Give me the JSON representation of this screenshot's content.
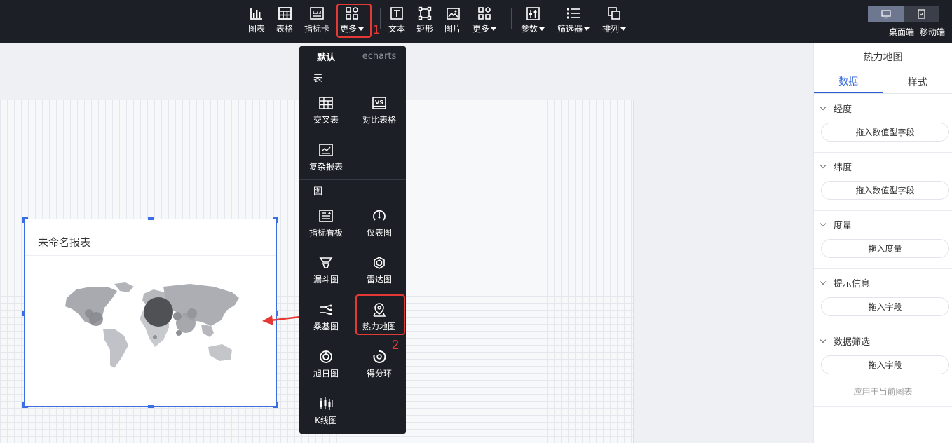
{
  "toolbar": {
    "items": [
      {
        "label": "图表",
        "icon": "bar-chart-icon"
      },
      {
        "label": "表格",
        "icon": "table-icon"
      },
      {
        "label": "指标卡",
        "icon": "metric-card-icon"
      },
      {
        "label": "更多",
        "icon": "grid-icon",
        "dropdown": true
      },
      {
        "label": "文本",
        "icon": "text-icon"
      },
      {
        "label": "矩形",
        "icon": "rectangle-icon"
      },
      {
        "label": "图片",
        "icon": "image-icon"
      },
      {
        "label": "更多",
        "icon": "grid-icon",
        "dropdown": true
      },
      {
        "label": "参数",
        "icon": "slider-icon",
        "dropdown": true
      },
      {
        "label": "筛选器",
        "icon": "filter-list-icon",
        "dropdown": true
      },
      {
        "label": "排列",
        "icon": "arrange-icon",
        "dropdown": true
      }
    ],
    "device": {
      "desktop": "桌面端",
      "mobile": "移动端"
    }
  },
  "annotations": {
    "step1": "1",
    "step2": "2"
  },
  "widget": {
    "title": "未命名报表"
  },
  "dropdown": {
    "tabs": [
      "默认",
      "echarts"
    ],
    "section_table": "表",
    "section_chart": "图",
    "table_items": [
      {
        "label": "交叉表",
        "icon": "cross-table-icon"
      },
      {
        "label": "对比表格",
        "icon": "compare-table-icon"
      },
      {
        "label": "复杂报表",
        "icon": "complex-report-icon"
      }
    ],
    "chart_items": [
      {
        "label": "指标看板",
        "icon": "metric-board-icon"
      },
      {
        "label": "仪表图",
        "icon": "gauge-icon"
      },
      {
        "label": "漏斗图",
        "icon": "funnel-icon"
      },
      {
        "label": "雷达图",
        "icon": "radar-icon"
      },
      {
        "label": "桑基图",
        "icon": "sankey-icon"
      },
      {
        "label": "热力地图",
        "icon": "map-pin-icon"
      },
      {
        "label": "旭日图",
        "icon": "sunburst-icon"
      },
      {
        "label": "得分环",
        "icon": "score-ring-icon"
      },
      {
        "label": "K线图",
        "icon": "candlestick-icon"
      }
    ]
  },
  "panel": {
    "title": "热力地图",
    "tabs": [
      "数据",
      "样式"
    ],
    "groups": [
      {
        "label": "经度",
        "drop": "拖入数值型字段"
      },
      {
        "label": "纬度",
        "drop": "拖入数值型字段"
      },
      {
        "label": "度量",
        "drop": "拖入度量"
      },
      {
        "label": "提示信息",
        "drop": "拖入字段"
      },
      {
        "label": "数据筛选",
        "drop": "拖入字段",
        "note": "应用于当前图表"
      }
    ]
  },
  "colors": {
    "accent": "#2b5fd9",
    "highlight": "#e53935",
    "toolbar_bg": "#1c1f26"
  }
}
